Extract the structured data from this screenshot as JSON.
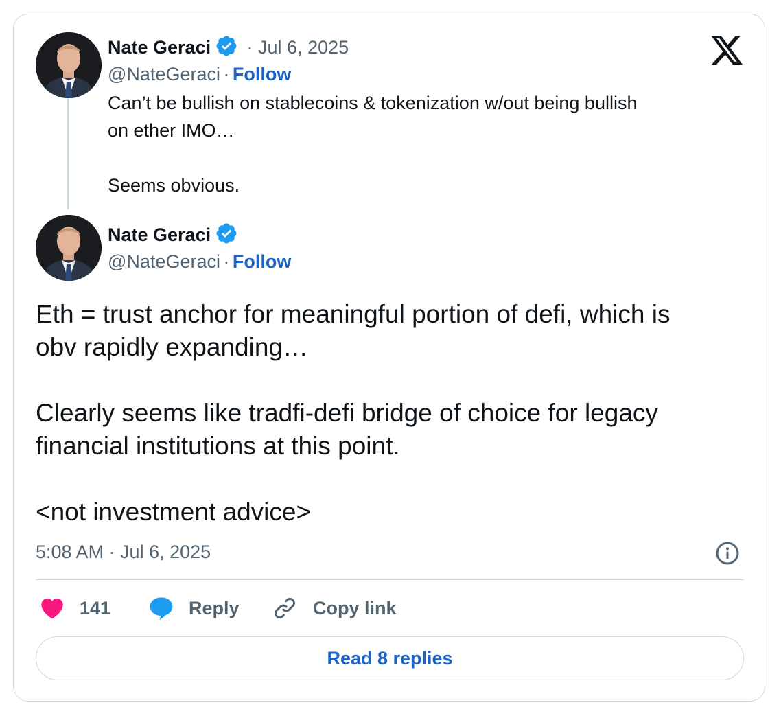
{
  "brand": {
    "logo_icon": "x-logo-icon"
  },
  "quoted_tweet": {
    "author_name": "Nate Geraci",
    "handle": "@NateGeraci",
    "separator": "·",
    "follow_label": "Follow",
    "date": "· Jul 6, 2025",
    "text": "Can’t be bullish on stablecoins & tokenization w/out being bullish\non ether IMO…\n\nSeems obvious."
  },
  "main_tweet": {
    "author_name": "Nate Geraci",
    "handle": "@NateGeraci",
    "separator": "·",
    "follow_label": "Follow",
    "text": "Eth = trust anchor for meaningful portion of defi, which is\nobv rapidly expanding…\n\nClearly seems like tradfi-defi bridge of choice for legacy\nfinancial institutions at this point.\n\n<not investment advice>",
    "timestamp": "5:08 AM · Jul 6, 2025"
  },
  "actions": {
    "like_count": "141",
    "reply_label": "Reply",
    "copy_link_label": "Copy link",
    "read_replies_label": "Read 8 replies"
  },
  "colors": {
    "link": "#1d64c9",
    "verified": "#1d9bf0",
    "like": "#f91880",
    "reply_bubble": "#1d9bf0",
    "secondary_text": "#536471"
  }
}
